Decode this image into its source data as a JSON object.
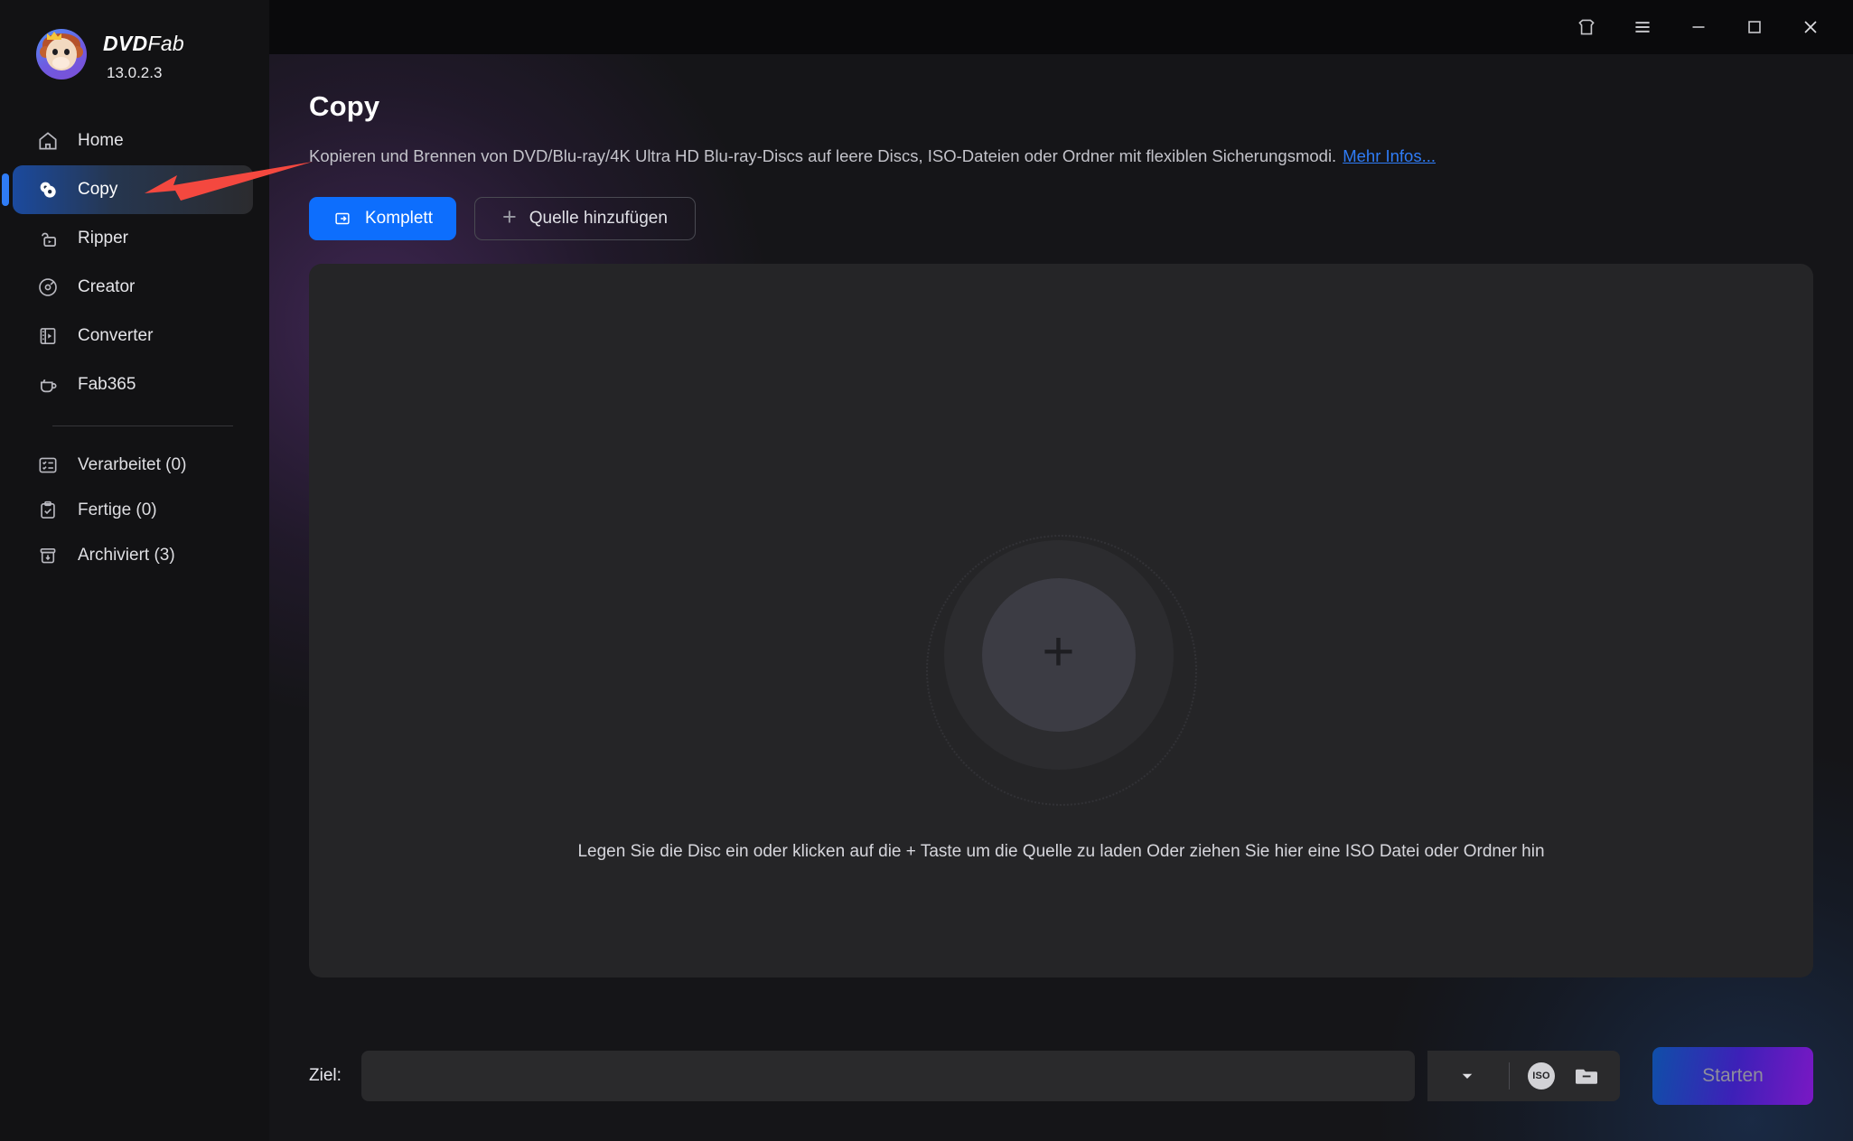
{
  "window": {
    "titlebar_buttons": [
      {
        "name": "theme-shirt-icon",
        "label": "Theme"
      },
      {
        "name": "menu-icon",
        "label": "Menu"
      },
      {
        "name": "minimize-icon",
        "label": "Minimize"
      },
      {
        "name": "maximize-icon",
        "label": "Maximize"
      },
      {
        "name": "close-icon",
        "label": "Close"
      }
    ]
  },
  "sidebar": {
    "brand_dvd": "DVD",
    "brand_fab": "Fab",
    "version": "13.0.2.3",
    "items": [
      {
        "label": "Home",
        "icon": "home-icon",
        "active": false
      },
      {
        "label": "Copy",
        "icon": "disc-copy-icon",
        "active": true
      },
      {
        "label": "Ripper",
        "icon": "ripper-folder-icon",
        "active": false
      },
      {
        "label": "Creator",
        "icon": "disc-creator-icon",
        "active": false
      },
      {
        "label": "Converter",
        "icon": "film-strip-icon",
        "active": false
      },
      {
        "label": "Fab365",
        "icon": "coffee-cup-icon",
        "active": false
      }
    ],
    "status_items": [
      {
        "label": "Verarbeitet (0)",
        "icon": "task-list-icon"
      },
      {
        "label": "Fertige (0)",
        "icon": "clipboard-check-icon"
      },
      {
        "label": "Archiviert (3)",
        "icon": "archive-box-icon"
      }
    ]
  },
  "main": {
    "title": "Copy",
    "description": "Kopieren und Brennen von DVD/Blu-ray/4K Ultra HD Blu-ray-Discs auf leere Discs, ISO-Dateien oder Ordner mit flexiblen Sicherungsmodi.",
    "more_link": "Mehr Infos...",
    "buttons": {
      "mode_label": "Komplett",
      "add_source_label": "Quelle hinzufügen"
    },
    "dropzone": {
      "plus": "+",
      "hint": "Legen Sie die Disc ein oder klicken auf die + Taste um die Quelle zu laden Oder ziehen Sie hier eine ISO Datei oder Ordner hin"
    }
  },
  "bottom": {
    "target_label": "Ziel:",
    "target_value": "",
    "target_placeholder": "",
    "iso_badge": "ISO",
    "start_label": "Starten"
  },
  "annotation": {
    "arrow_color": "#f4483f",
    "points_at": "Copy"
  },
  "colors": {
    "accent_blue": "#0d6efd",
    "link_blue": "#2f7cf6",
    "sidebar_bg": "#121214",
    "panel_bg": "#252527",
    "start_gradient_from": "#0f4fa8",
    "start_gradient_to": "#7a18c4"
  }
}
